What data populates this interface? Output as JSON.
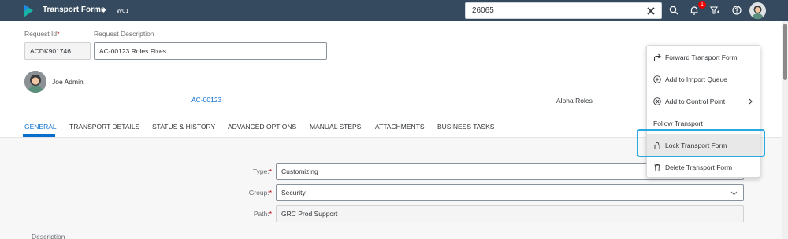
{
  "shell": {
    "app_title": "Transport Forms",
    "app_subtitle": "W01",
    "search_value": "26065",
    "notification_count": "1"
  },
  "header": {
    "request_id_label": "Request Id",
    "request_id_value": "ACDK901746",
    "request_desc_label": "Request Description",
    "request_desc_value": "AC-00123 Roles Fixes",
    "user_name": "Joe Admin",
    "link_text": "AC-00123",
    "alpha_text": "Alpha Roles",
    "more_button": "∘∘∘"
  },
  "tabs": [
    "GENERAL",
    "TRANSPORT DETAILS",
    "STATUS & HISTORY",
    "ADVANCED OPTIONS",
    "MANUAL STEPS",
    "ATTACHMENTS",
    "BUSINESS TASKS"
  ],
  "form": {
    "type_label": "Type:",
    "type_value": "Customizing",
    "group_label": "Group:",
    "group_value": "Security",
    "path_label": "Path:",
    "path_value": "GRC Prod Support",
    "required_marker": "*",
    "description_label": "Description"
  },
  "menu": {
    "items": [
      {
        "label": "Forward Transport Form",
        "icon": "forward-icon"
      },
      {
        "label": "Add to Import Queue",
        "icon": "add-circle-icon"
      },
      {
        "label": "Add to Control Point",
        "icon": "rewind-circle-icon"
      },
      {
        "label": "Follow Transport",
        "icon": ""
      },
      {
        "label": "Lock Transport Form",
        "icon": "lock-icon"
      },
      {
        "label": "Delete Transport Form",
        "icon": "trash-icon"
      }
    ]
  },
  "colors": {
    "shell": "#354a5f",
    "accent": "#0a6ed1",
    "highlight": "#29a8e0",
    "required": "#bb0000"
  }
}
